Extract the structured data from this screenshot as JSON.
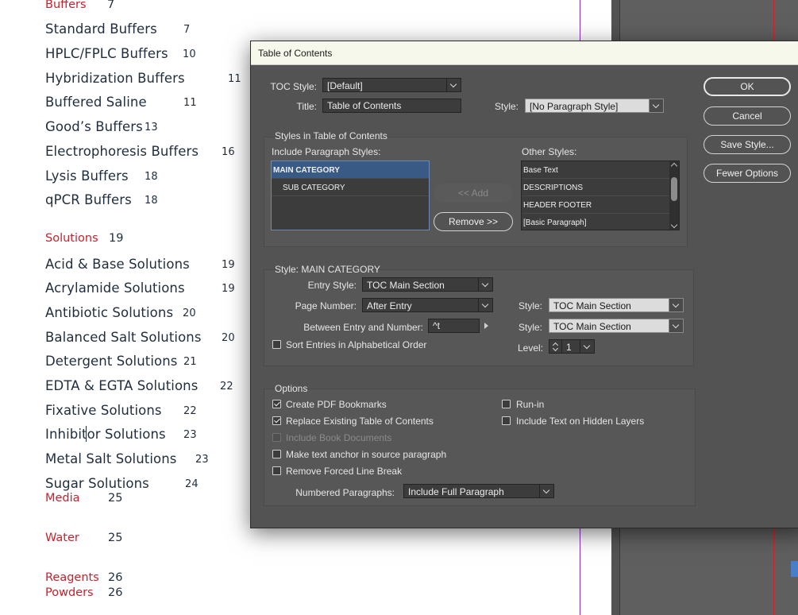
{
  "document": {
    "entries": [
      {
        "label": "Buffers",
        "page": "7",
        "kind": "category"
      },
      {
        "label": "Standard Buffers",
        "page": "7",
        "kind": "entry"
      },
      {
        "label": "HPLC/FPLC Buffers",
        "page": "10",
        "kind": "entry"
      },
      {
        "label": "Hybridization Buffers",
        "page": "11",
        "kind": "entry"
      },
      {
        "label": "Buffered Saline",
        "page": "11",
        "kind": "entry"
      },
      {
        "label": "Good’s Buffers",
        "page": "13",
        "kind": "entry"
      },
      {
        "label": "Electrophoresis Buffers",
        "page": "16",
        "kind": "entry"
      },
      {
        "label": "Lysis Buffers",
        "page": "18",
        "kind": "entry"
      },
      {
        "label": "qPCR Buffers",
        "page": "18",
        "kind": "entry"
      },
      {
        "label": "Solutions",
        "page": "19",
        "kind": "category"
      },
      {
        "label": "Acid & Base Solutions",
        "page": "19",
        "kind": "entry"
      },
      {
        "label": "Acrylamide Solutions",
        "page": "19",
        "kind": "entry"
      },
      {
        "label": "Antibiotic Solutions",
        "page": "20",
        "kind": "entry"
      },
      {
        "label": "Balanced Salt Solutions",
        "page": "20",
        "kind": "entry"
      },
      {
        "label": "Detergent Solutions",
        "page": "21",
        "kind": "entry"
      },
      {
        "label": "EDTA & EGTA Solutions",
        "page": "22",
        "kind": "entry"
      },
      {
        "label": "Fixative Solutions",
        "page": "22",
        "kind": "entry"
      },
      {
        "label": "Inhibitor Solutions",
        "page": "23",
        "kind": "entry"
      },
      {
        "label": "Metal Salt Solutions",
        "page": "23",
        "kind": "entry"
      },
      {
        "label": "Sugar Solutions",
        "page": "24",
        "kind": "entry"
      },
      {
        "label": "Media",
        "page": "25",
        "kind": "category"
      },
      {
        "label": "Water",
        "page": "25",
        "kind": "category"
      },
      {
        "label": "Reagents",
        "page": "26",
        "kind": "category"
      },
      {
        "label": "Powders",
        "page": "26",
        "kind": "category"
      }
    ]
  },
  "dialog": {
    "title": "Table of Contents",
    "toc_style_label": "TOC Style:",
    "toc_style_value": "[Default]",
    "title_label": "Title:",
    "title_value": "Table of Contents",
    "title_style_label": "Style:",
    "title_style_value": "[No Paragraph Style]",
    "styles_group_label": "Styles in Table of Contents",
    "include_label": "Include Paragraph Styles:",
    "included_styles": [
      "MAIN CATEGORY",
      "SUB CATEGORY"
    ],
    "other_label": "Other Styles:",
    "other_styles": [
      "Base Text",
      "DESCRIPTIONS",
      "HEADER FOOTER",
      "[Basic Paragraph]"
    ],
    "add_button": "<< Add",
    "remove_button": "Remove >>",
    "style_group_label": "Style: MAIN CATEGORY",
    "entry_style_label": "Entry Style:",
    "entry_style_value": "TOC Main Section",
    "page_number_label": "Page Number:",
    "page_number_value": "After Entry",
    "page_number_style_label": "Style:",
    "page_number_style_value": "TOC Main Section",
    "between_label": "Between Entry and Number:",
    "between_value": "^t",
    "between_style_label": "Style:",
    "between_style_value": "TOC Main Section",
    "sort_label": "Sort Entries in Alphabetical Order",
    "sort_checked": false,
    "level_label": "Level:",
    "level_value": "1",
    "options_label": "Options",
    "opt_pdf_bookmarks": "Create PDF Bookmarks",
    "opt_replace_existing": "Replace Existing Table of Contents",
    "opt_include_book": "Include Book Documents",
    "opt_text_anchor": "Make text anchor in source paragraph",
    "opt_remove_break": "Remove Forced Line Break",
    "opt_run_in": "Run-in",
    "opt_hidden_layers": "Include Text on Hidden Layers",
    "numbered_label": "Numbered Paragraphs:",
    "numbered_value": "Include Full Paragraph",
    "ok_button": "OK",
    "cancel_button": "Cancel",
    "save_style_button": "Save Style...",
    "fewer_options_button": "Fewer Options"
  },
  "colors": {
    "category_red": "#c8202c",
    "entry_navy": "#1f2d3d",
    "dialog_bg": "#535353",
    "selection_blue": "#3a5a86"
  }
}
